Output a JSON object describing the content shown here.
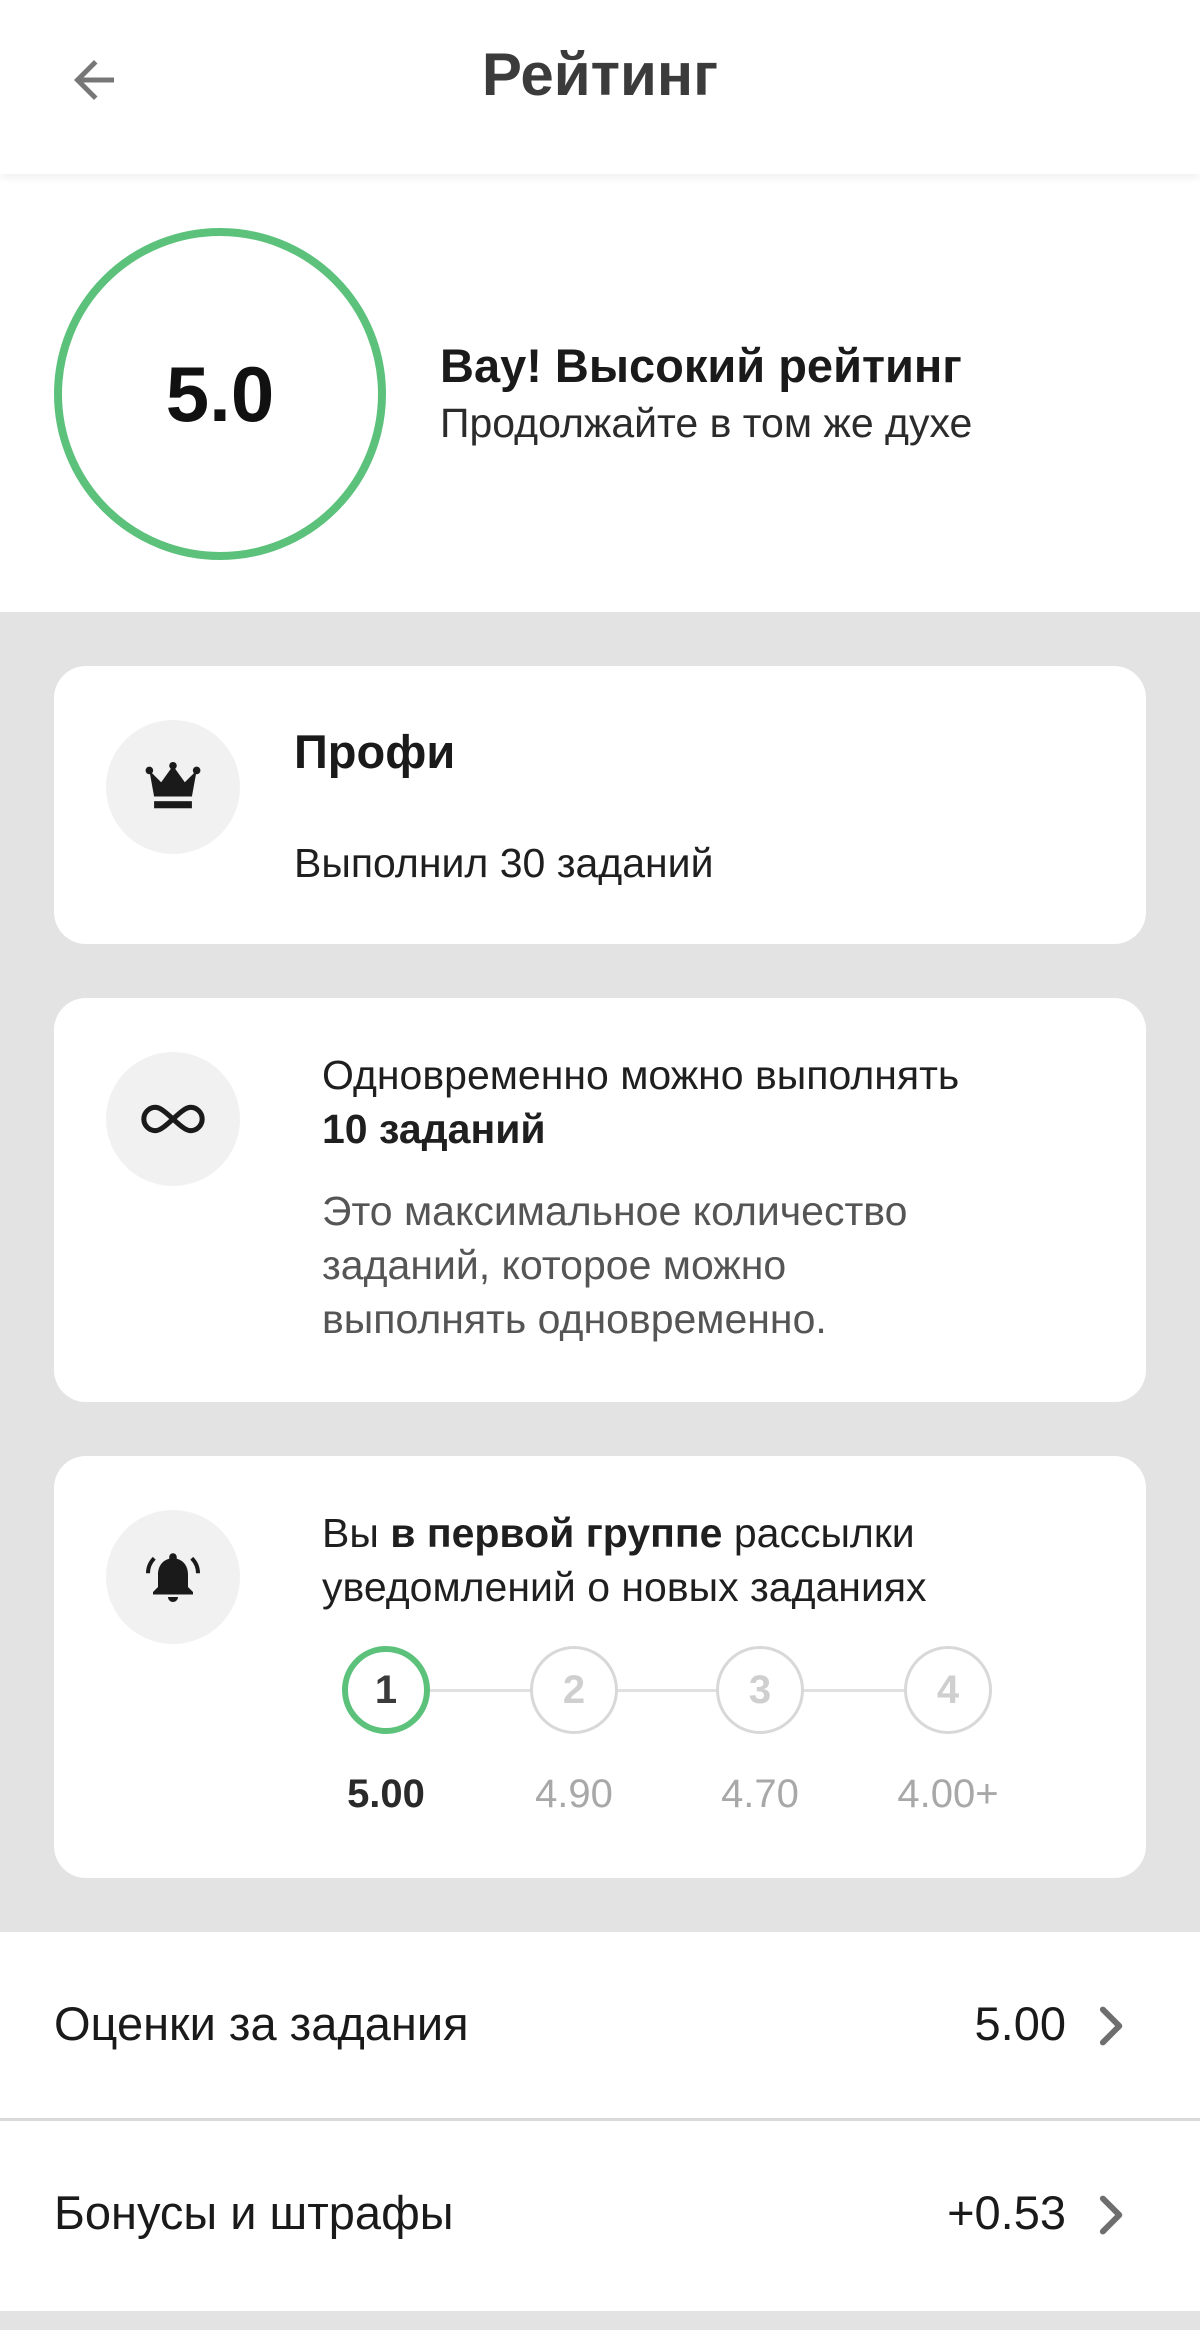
{
  "header": {
    "title": "Рейтинг",
    "back_icon": "arrow-left-icon"
  },
  "hero": {
    "rating": "5.0",
    "title": "Вау! Высокий рейтинг",
    "subtitle": "Продолжайте в том же духе",
    "accent_color": "#5cc27b"
  },
  "cards": {
    "level": {
      "icon": "crown-icon",
      "title": "Профи",
      "text": "Выполнил 30 заданий"
    },
    "concurrency": {
      "icon": "infinity-icon",
      "line1": "Одновременно можно выполнять",
      "bold": "10 заданий",
      "description_line1": "Это максимальное количество",
      "description_line2": "заданий, которое можно",
      "description_line3": "выполнять одновременно."
    },
    "notifications": {
      "icon": "bell-icon",
      "prefix": "Вы ",
      "bold": "в первой группе",
      "suffix": " рассылки",
      "line2": "уведомлений о новых заданиях",
      "steps": [
        {
          "number": "1",
          "value": "5.00",
          "active": true
        },
        {
          "number": "2",
          "value": "4.90",
          "active": false
        },
        {
          "number": "3",
          "value": "4.70",
          "active": false
        },
        {
          "number": "4",
          "value": "4.00+",
          "active": false
        }
      ]
    }
  },
  "rows": [
    {
      "label": "Оценки за задания",
      "value": "5.00"
    },
    {
      "label": "Бонусы и штрафы",
      "value": "+0.53"
    }
  ]
}
